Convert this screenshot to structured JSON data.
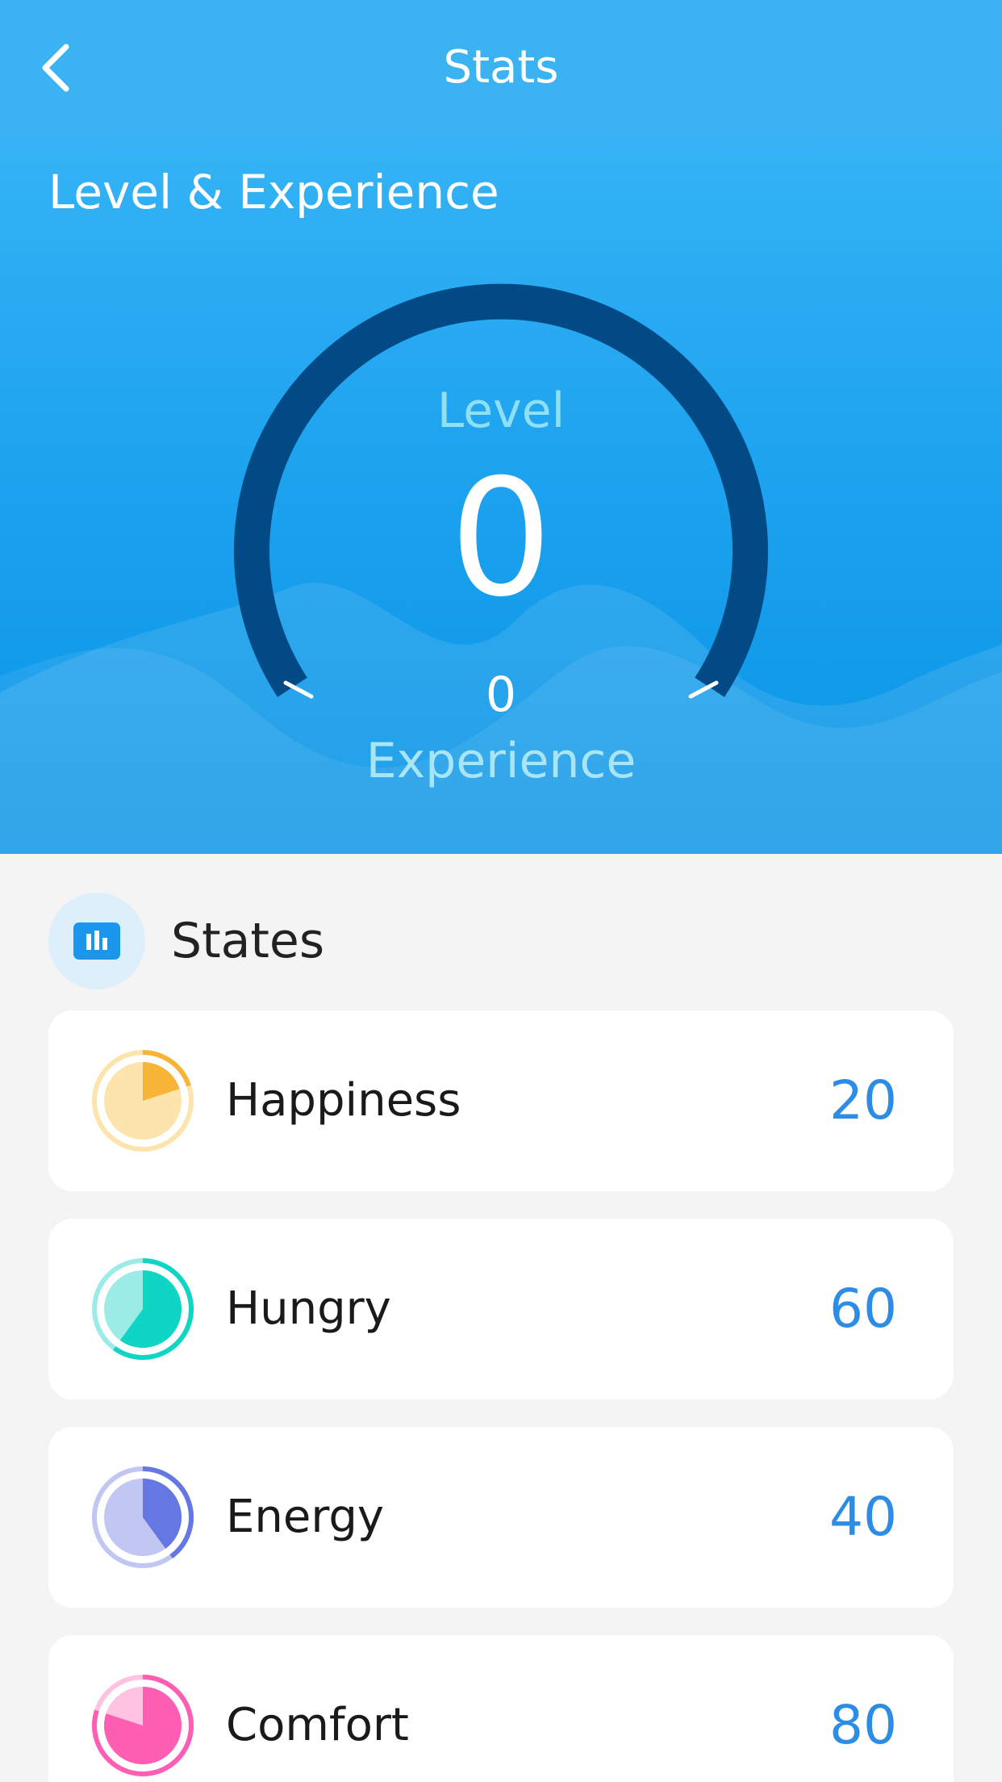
{
  "header": {
    "title": "Stats",
    "back_icon": "chevron-left-icon"
  },
  "level_section": {
    "title": "Level & Experience",
    "level_label": "Level",
    "level_value": "0",
    "experience_value": "0",
    "experience_label": "Experience",
    "gauge_progress": 0,
    "colors": {
      "gauge_track": "#024a85",
      "hero_top": "#35b3f5",
      "hero_bottom": "#0794e6"
    }
  },
  "states_section": {
    "title": "States",
    "icon": "bar-chart-icon",
    "items": [
      {
        "label": "Happiness",
        "value": "20",
        "fraction": 0.2,
        "color": "#f8b437",
        "light": "#fde4ad"
      },
      {
        "label": "Hungry",
        "value": "60",
        "fraction": 0.6,
        "color": "#0ed5c4",
        "light": "#9bece6"
      },
      {
        "label": "Energy",
        "value": "40",
        "fraction": 0.4,
        "color": "#6477e2",
        "light": "#c1c7f2"
      },
      {
        "label": "Comfort",
        "value": "80",
        "fraction": 0.8,
        "color": "#ff5fb3",
        "light": "#ffc2e1"
      }
    ],
    "value_color": "#2d8de6"
  }
}
